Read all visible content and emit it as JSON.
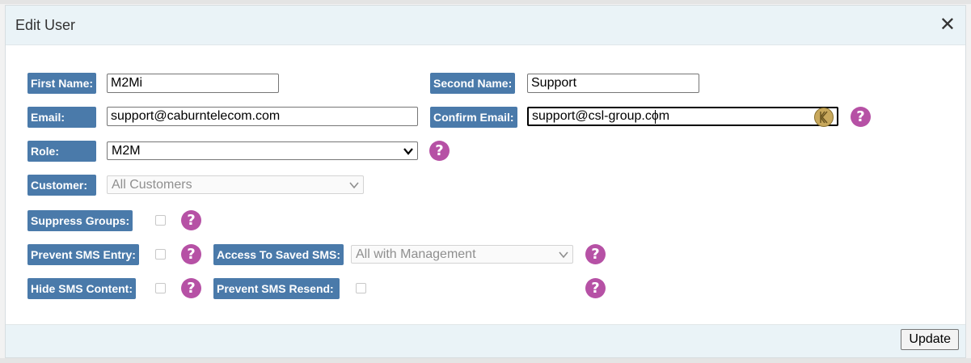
{
  "dialog": {
    "title": "Edit User",
    "close_label": "✕",
    "update_label": "Update"
  },
  "fields": {
    "first_name": {
      "label": "First Name:",
      "value": "M2Mi"
    },
    "second_name": {
      "label": "Second Name:",
      "value": "Support"
    },
    "email": {
      "label": "Email:",
      "value": "support@caburntelecom.com"
    },
    "confirm_email": {
      "label": "Confirm Email:",
      "value": "support@csl-group.com"
    },
    "role": {
      "label": "Role:",
      "value": "M2M"
    },
    "customer": {
      "label": "Customer:",
      "value": "All Customers"
    },
    "suppress_groups": {
      "label": "Suppress Groups:",
      "checked": false
    },
    "prevent_sms_entry": {
      "label": "Prevent SMS Entry:",
      "checked": false
    },
    "access_saved_sms": {
      "label": "Access To Saved SMS:",
      "value": "All with Management"
    },
    "hide_sms_content": {
      "label": "Hide SMS Content:",
      "checked": false
    },
    "prevent_sms_resend": {
      "label": "Prevent SMS Resend:",
      "checked": false
    }
  },
  "help_glyph": "?",
  "icons": {
    "help": "question-circle-icon",
    "chevron": "chevron-down-icon",
    "close": "close-icon",
    "password_manager": "keeper-icon"
  },
  "colors": {
    "label_bg": "#4a7aaa",
    "help_bg": "#b651a5",
    "header_bg": "#eaf3f7"
  }
}
